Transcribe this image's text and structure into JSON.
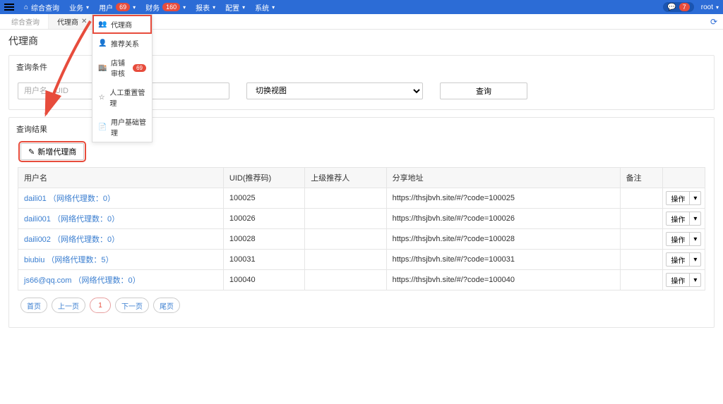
{
  "nav": {
    "home": "综合查询",
    "items": [
      {
        "label": "业务",
        "badge": null
      },
      {
        "label": "用户",
        "badge": "69"
      },
      {
        "label": "财务",
        "badge": "160"
      },
      {
        "label": "报表",
        "badge": null
      },
      {
        "label": "配置",
        "badge": null
      },
      {
        "label": "系统",
        "badge": null
      }
    ],
    "chat_count": "7",
    "user": "root"
  },
  "tabs": [
    {
      "label": "综合查询",
      "closable": false,
      "active": false
    },
    {
      "label": "代理商",
      "closable": true,
      "active": true
    }
  ],
  "dropdown": {
    "items": [
      {
        "icon": "👥",
        "label": "代理商",
        "highlight": true
      },
      {
        "icon": "👤",
        "label": "推荐关系"
      },
      {
        "icon": "🏬",
        "label": "店铺审核",
        "badge": "69"
      },
      {
        "icon": "☆",
        "label": "人工重置管理"
      },
      {
        "icon": "📄",
        "label": "用户基础管理"
      }
    ]
  },
  "page": {
    "title": "代理商"
  },
  "cond": {
    "title": "查询条件",
    "username_ph": "用户名、UID",
    "select_value": "切换视图",
    "search_btn": "查询"
  },
  "results": {
    "title": "查询结果",
    "add_btn": "新增代理商",
    "columns": [
      "用户名",
      "UID(推荐码)",
      "上级推荐人",
      "分享地址",
      "备注",
      ""
    ],
    "rows": [
      {
        "user": "daili01",
        "count": "（网络代理数：0）",
        "uid": "100025",
        "sup": "",
        "url": "https://thsjbvh.site/#/?code=100025",
        "note": ""
      },
      {
        "user": "daili001",
        "count": "（网络代理数：0）",
        "uid": "100026",
        "sup": "",
        "url": "https://thsjbvh.site/#/?code=100026",
        "note": ""
      },
      {
        "user": "daili002",
        "count": "（网络代理数：0）",
        "uid": "100028",
        "sup": "",
        "url": "https://thsjbvh.site/#/?code=100028",
        "note": ""
      },
      {
        "user": "biubiu",
        "count": "（网络代理数：5）",
        "uid": "100031",
        "sup": "",
        "url": "https://thsjbvh.site/#/?code=100031",
        "note": ""
      },
      {
        "user": "js66@qq.com",
        "count": "（网络代理数：0）",
        "uid": "100040",
        "sup": "",
        "url": "https://thsjbvh.site/#/?code=100040",
        "note": ""
      }
    ],
    "op_label": "操作"
  },
  "pagination": {
    "first": "首页",
    "prev": "上一页",
    "current": "1",
    "next": "下一页",
    "last": "尾页"
  }
}
